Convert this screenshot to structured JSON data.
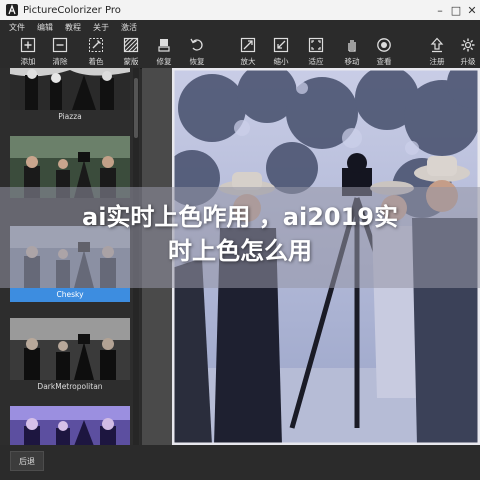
{
  "window": {
    "title": "PictureColorizer Pro"
  },
  "menu": [
    "文件",
    "编辑",
    "教程",
    "关于",
    "激活"
  ],
  "toolbar": [
    {
      "label": "添加",
      "icon": "add-icon"
    },
    {
      "label": "清除",
      "icon": "clear-icon"
    },
    {
      "label": "着色",
      "icon": "colorize-icon"
    },
    {
      "label": "蒙版",
      "icon": "mask-icon"
    },
    {
      "label": "修复",
      "icon": "repair-icon"
    },
    {
      "label": "恢复",
      "icon": "restore-icon"
    },
    {
      "label": "放大",
      "icon": "zoom-in-icon"
    },
    {
      "label": "缩小",
      "icon": "zoom-out-icon"
    },
    {
      "label": "适应",
      "icon": "fit-icon"
    },
    {
      "label": "移动",
      "icon": "move-hand-icon"
    },
    {
      "label": "查看",
      "icon": "view-icon"
    },
    {
      "label": "注册",
      "icon": "register-icon"
    },
    {
      "label": "升级",
      "icon": "upgrade-icon"
    }
  ],
  "presets": [
    {
      "label": "Piazza",
      "selected": false
    },
    {
      "label": "",
      "selected": false
    },
    {
      "label": "Chesky",
      "selected": true
    },
    {
      "label": "DarkMetropolitan",
      "selected": false
    },
    {
      "label": "",
      "selected": false
    }
  ],
  "bottom": {
    "back_label": "后退"
  },
  "overlay": {
    "line1": "ai实时上色咋用 ，ai2019实",
    "line2": "时上色怎么用"
  }
}
